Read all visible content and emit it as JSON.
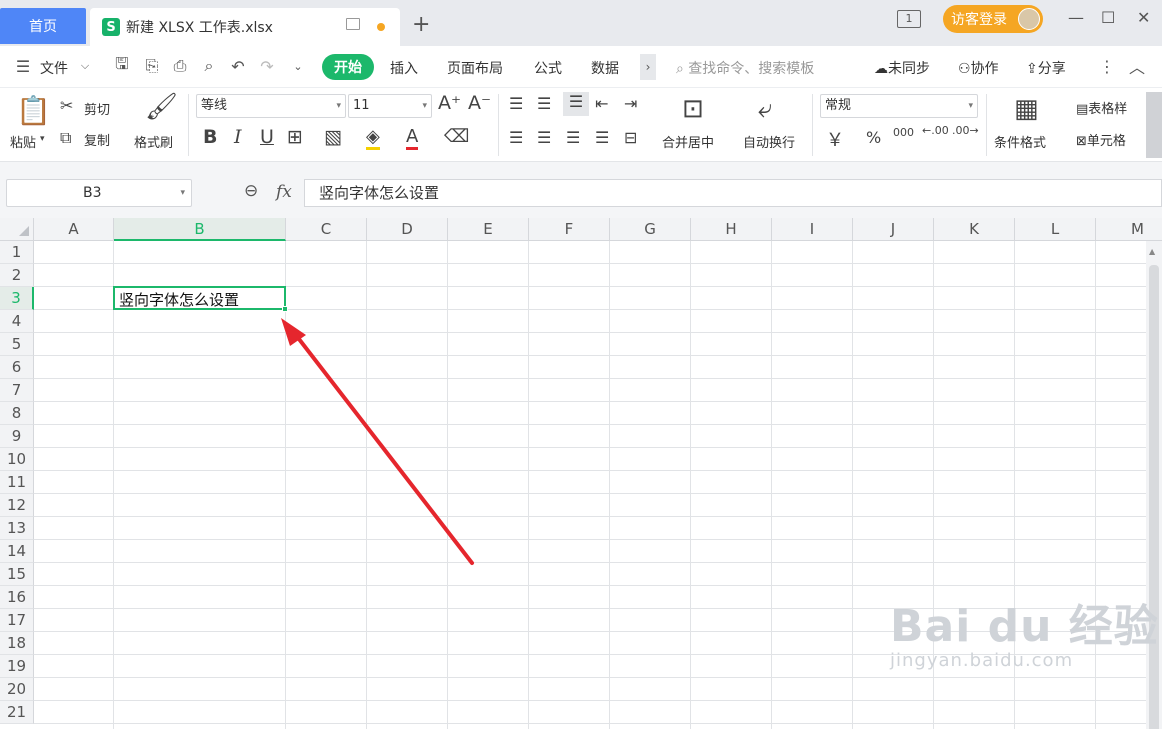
{
  "titlebar": {
    "home_tab": "首页",
    "doc_tab": "新建 XLSX 工作表.xlsx",
    "doc_icon_letter": "S",
    "add_tab": "+",
    "window_badge": "1",
    "login": "访客登录",
    "minimize": "—",
    "maximize": "☐",
    "close": "✕"
  },
  "menu": {
    "file": "文件",
    "start": "开始",
    "insert": "插入",
    "page_layout": "页面布局",
    "formula": "公式",
    "data": "数据",
    "search_placeholder": "查找命令、搜索模板",
    "unsynced": "未同步",
    "collab": "协作",
    "share": "分享"
  },
  "ribbon": {
    "paste": "粘贴",
    "cut": "剪切",
    "copy": "复制",
    "format_painter": "格式刷",
    "font_name": "等线",
    "font_size": "11",
    "bold": "B",
    "italic": "I",
    "underline": "U",
    "font_color_glyph": "A",
    "merge_center": "合并居中",
    "wrap_text": "自动换行",
    "number_format": "常规",
    "currency": "￥",
    "percent": "%",
    "thousands": "000",
    "dec_inc": ".00",
    "dec_dec": ".00",
    "conditional_format": "条件格式",
    "table_style": "表格样",
    "cell_style": "单元格"
  },
  "formula_bar": {
    "name_box": "B3",
    "fx": "fx",
    "content": "竖向字体怎么设置"
  },
  "sheet": {
    "columns": [
      "A",
      "B",
      "C",
      "D",
      "E",
      "F",
      "G",
      "H",
      "I",
      "J",
      "K",
      "L",
      "M"
    ],
    "rows": [
      "1",
      "2",
      "3",
      "4",
      "5",
      "6",
      "7",
      "8",
      "9",
      "10",
      "11",
      "12",
      "13",
      "14",
      "15",
      "16",
      "17",
      "18",
      "19",
      "20",
      "21"
    ],
    "active_cell": "B3",
    "active_cell_value": "竖向字体怎么设置"
  },
  "watermark": {
    "brand": "Bai du 经验",
    "url": "jingyan.baidu.com"
  },
  "colors": {
    "accent_green": "#1cb86b",
    "home_tab_blue": "#4f86f7",
    "login_orange": "#f5a623",
    "arrow_red": "#e5262d"
  }
}
